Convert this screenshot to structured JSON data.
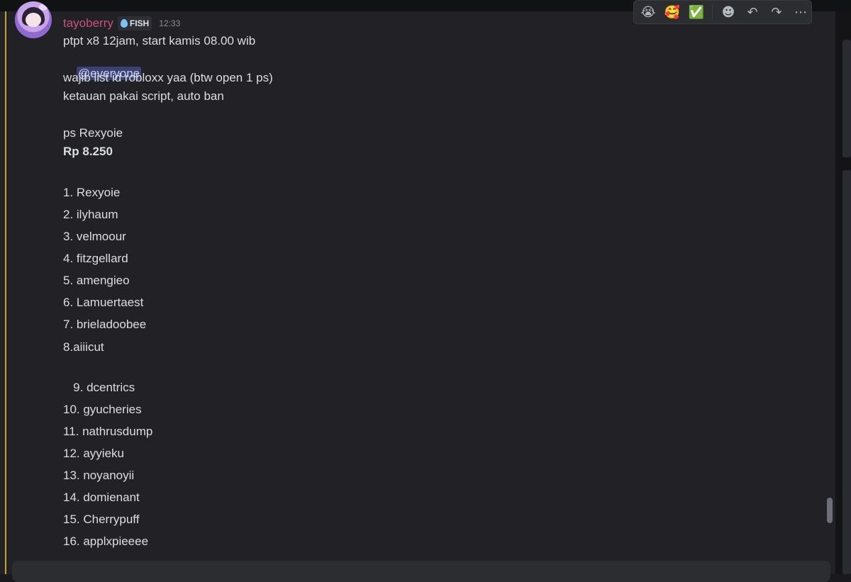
{
  "message": {
    "author": "tayoberry",
    "role_tag": "FISH",
    "time": "12:33",
    "lines": {
      "l1": "ptpt x8 12jam, start kamis 08.00 wib",
      "mention": "@everyone",
      "l3": "wajib list id robloxx yaa (btw open 1 ps)",
      "l4": "ketauan pakai script, auto ban",
      "l5": "ps Rexyoie",
      "price": "Rp 8.250",
      "list": [
        "1. Rexyoie",
        "2. ilyhaum",
        "3. velmoour",
        "4. fitzgellard",
        "5. amengieo",
        "6. Lamuertaest",
        "7. brieladoobee",
        "8.aiiicut"
      ],
      "list2": [
        "   9. dcentrics",
        "10. gyucheries",
        "11. nathrusdump",
        "12. ayyieku",
        "13. noyanoyii",
        "14. domienant",
        "15. Cherrypuff",
        "16. applxpieeee"
      ]
    }
  },
  "toolbar": {
    "reaction_1": "😭",
    "reaction_2": "🥰",
    "reaction_3": "✅",
    "add_reaction_icon": "☻",
    "reply_icon": "↶",
    "forward_icon": "↷",
    "more_icon": "⋯"
  },
  "colors": {
    "username": "#c94f7c",
    "mention_bg": "#3c4270",
    "mention_text": "#c9cdfb",
    "mention_bar": "#c9a227"
  }
}
